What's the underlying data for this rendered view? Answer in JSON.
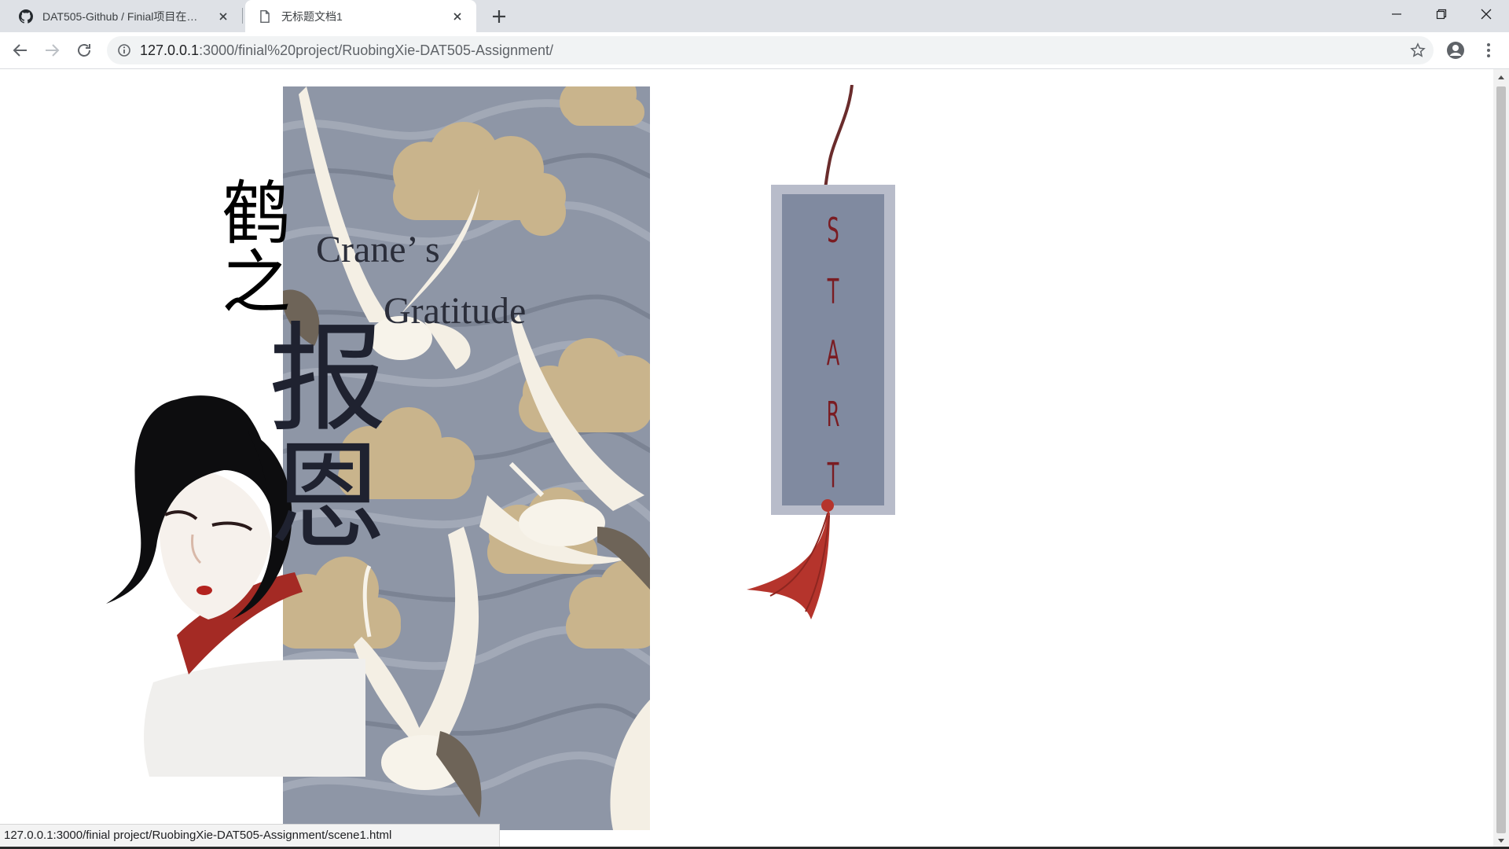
{
  "tabs": [
    {
      "title": "DAT505-Github / Finial项目在…",
      "favicon": "github-icon"
    },
    {
      "title": "无标题文档1",
      "favicon": "document-icon"
    }
  ],
  "toolbar": {
    "url_host": "127.0.0.1",
    "url_rest": ":3000/finial%20project/RuobingXie-DAT505-Assignment/"
  },
  "page": {
    "title_cn": [
      "鹤",
      "之",
      "报",
      "恩"
    ],
    "title_en_line1": "Crane’ s",
    "title_en_line2": "Gratitude",
    "start_letters": [
      "S",
      "T",
      "A",
      "R",
      "T"
    ]
  },
  "status_url": "127.0.0.1:3000/finial project/RuobingXie-DAT505-Assignment/scene1.html",
  "colors": {
    "panel_bg": "#8e96a6",
    "cloud": "#c9b48c",
    "bookmark_frame": "#b8bcca",
    "bookmark_face": "#808aa0",
    "tassel": "#b5342c"
  }
}
